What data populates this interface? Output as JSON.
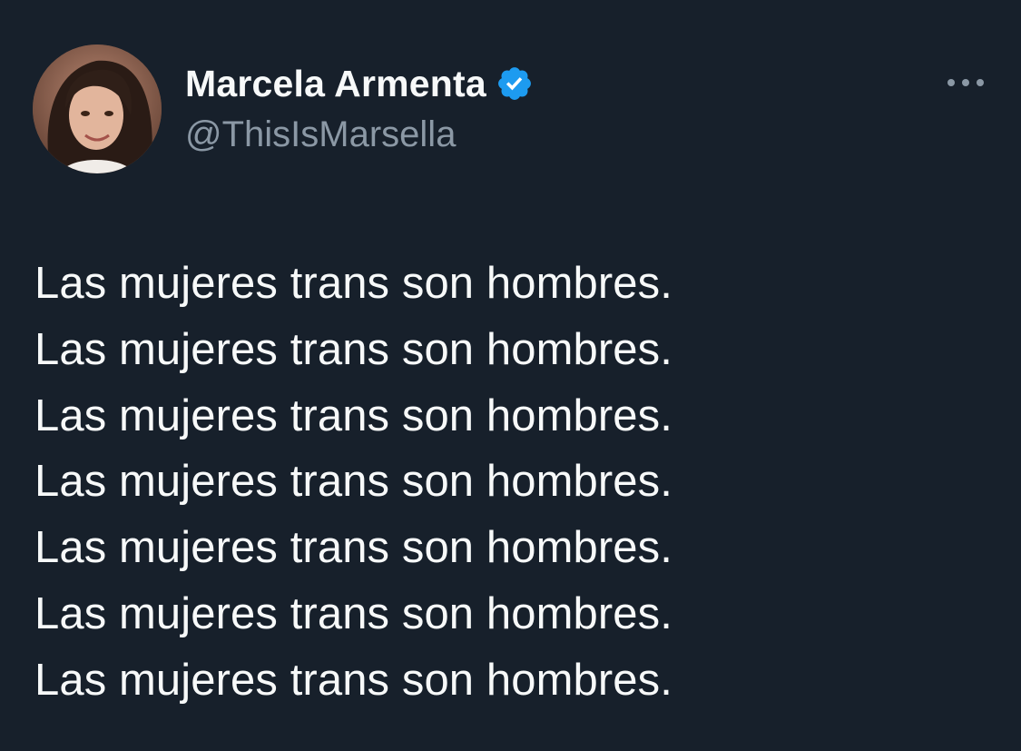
{
  "author": {
    "display_name": "Marcela Armenta",
    "handle": "@ThisIsMarsella",
    "verified": true,
    "verified_icon": "verified-badge-icon",
    "avatar_icon": "profile-photo"
  },
  "menu": {
    "icon": "more-horizontal-icon"
  },
  "tweet": {
    "lines": [
      "Las mujeres trans son hombres.",
      "Las mujeres trans son hombres.",
      "Las mujeres trans son hombres.",
      "Las mujeres trans son hombres.",
      "Las mujeres trans son hombres.",
      "Las mujeres trans son hombres.",
      "Las mujeres trans son hombres."
    ]
  },
  "colors": {
    "background": "#17202b",
    "text_primary": "#f7f9f9",
    "text_secondary": "#8b98a5",
    "verified_blue": "#1d9bf0"
  }
}
